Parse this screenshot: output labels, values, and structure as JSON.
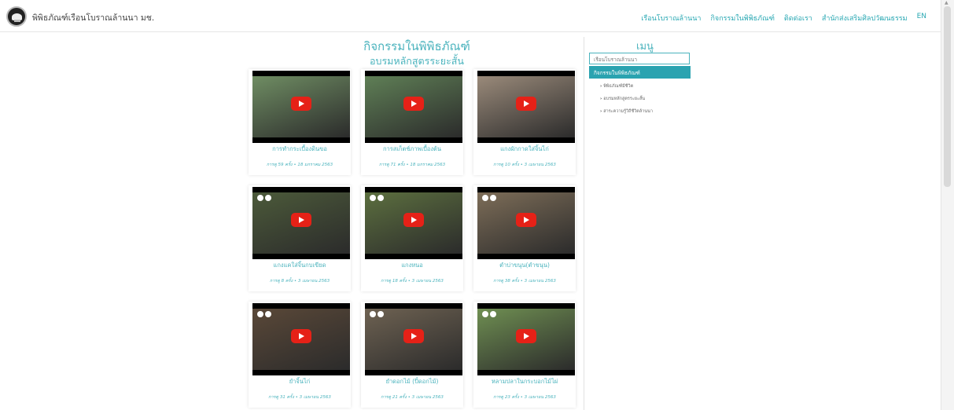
{
  "header": {
    "site_title": "พิพิธภัณฑ์เรือนโบราณล้านนา มช.",
    "nav": [
      "เรือนโบราณล้านนา",
      "กิจกรรมในพิพิธภัณฑ์",
      "ติดต่อเรา",
      "สำนักส่งเสริมศิลปวัฒนธรรม",
      "EN"
    ]
  },
  "main": {
    "title": "กิจกรรมในพิพิธภัณฑ์",
    "subtitle": "อบรมหลักสูตรระยะสั้น",
    "videos": [
      {
        "title": "การทำกระเบื้องดินขอ",
        "meta": "การดู 59 ครั้ง • 18 มกราคม 2563",
        "scene": "#6f8d63"
      },
      {
        "title": "การสเก็ตช์ภาพเบื้องต้น",
        "meta": "การดู 71 ครั้ง • 18 มกราคม 2563",
        "scene": "#5f7f56"
      },
      {
        "title": "แกงผักกาดใส่จิ้นไก่",
        "meta": "การดู 10 ครั้ง • 3 เมษายน 2563",
        "scene": "#9a8a7a"
      },
      {
        "title": "แกงแคใส่จิ้นกบเขียด",
        "meta": "การดู 8 ครั้ง • 3 เมษายน 2563",
        "scene": "#4c5a3a"
      },
      {
        "title": "แกงหนอ",
        "meta": "การดู 18 ครั้ง • 3 เมษายน 2563",
        "scene": "#5c6f3f"
      },
      {
        "title": "ตำบ่าขนุน(ตำขนุน)",
        "meta": "การดู 38 ครั้ง • 3 เมษายน 2563",
        "scene": "#7d6d58"
      },
      {
        "title": "ยำจิ้นไก่",
        "meta": "การดู 31 ครั้ง • 3 เมษายน 2563",
        "scene": "#5a4838"
      },
      {
        "title": "ยำดอกไม้ (ปี๋ดอกไม้)",
        "meta": "การดู 21 ครั้ง • 3 เมษายน 2563",
        "scene": "#6e6252"
      },
      {
        "title": "หลามปลาในกระบอกไม้ไผ่",
        "meta": "การดู 23 ครั้ง • 3 เมษายน 2563",
        "scene": "#6f8f52"
      }
    ]
  },
  "menu": {
    "title": "เมนู",
    "input_value": "เรือนโบราณล้านนา",
    "active_item": "กิจกรรมในพิพิธภัณฑ์",
    "sub_items": [
      "พิพิธภัณฑ์มีชีวิต",
      "อบรมหลักสูตรระยะสั้น",
      "สาระความรู้วิถีชีวิตล้านนา"
    ]
  },
  "colors": {
    "accent": "#4ab3bd",
    "active_bg": "#2aa3b0",
    "play": "#e62117"
  }
}
